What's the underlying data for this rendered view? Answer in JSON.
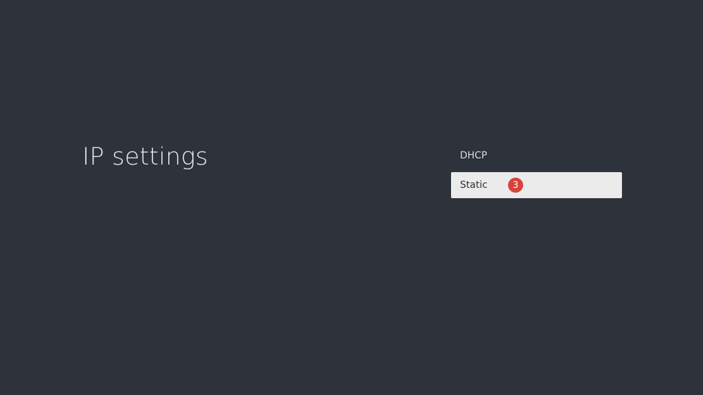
{
  "title": "IP settings",
  "options": [
    {
      "label": "DHCP",
      "selected": false
    },
    {
      "label": "Static",
      "selected": true,
      "badge": "3"
    }
  ],
  "colors": {
    "background": "#2e323a",
    "selected_bg": "#ebebeb",
    "badge": "#d9413c"
  }
}
